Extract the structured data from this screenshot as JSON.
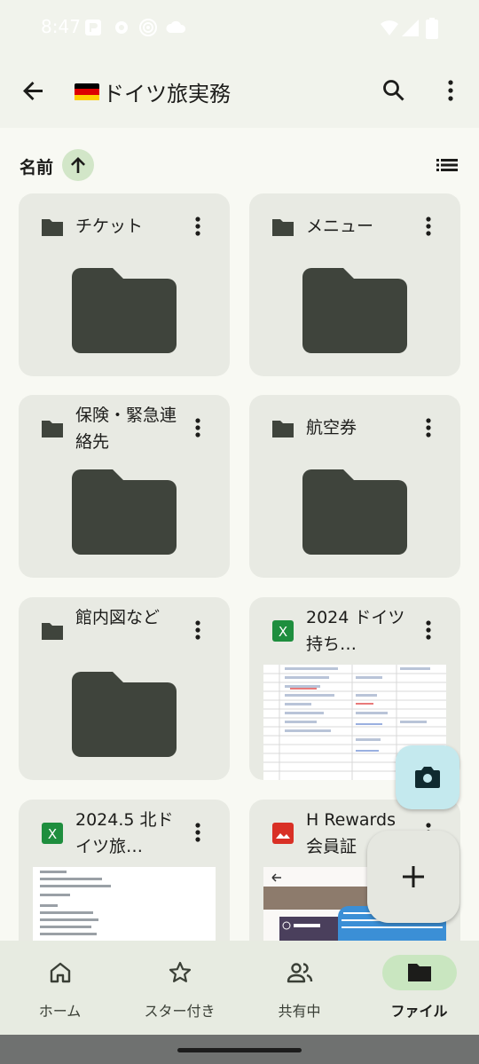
{
  "status_bar": {
    "time": "8:47"
  },
  "app_bar": {
    "flag": "🇩🇪",
    "title": "ドイツ旅実務"
  },
  "sort": {
    "label": "名前",
    "direction": "ascending"
  },
  "files": [
    {
      "name": "チケット",
      "type": "folder"
    },
    {
      "name": "メニュー",
      "type": "folder"
    },
    {
      "name": "保険・緊急連絡先",
      "type": "folder"
    },
    {
      "name": "航空券",
      "type": "folder"
    },
    {
      "name": "館内図など",
      "type": "folder"
    },
    {
      "name": "2024 ドイツ 持ち…",
      "type": "spreadsheet",
      "icon_letter": "X"
    },
    {
      "name": "2024.5 北ドイツ旅…",
      "type": "spreadsheet",
      "icon_letter": "X"
    },
    {
      "name": "H Rewards 会員証",
      "type": "image"
    }
  ],
  "bottom_nav": [
    {
      "label": "ホーム",
      "icon": "home-icon",
      "active": false
    },
    {
      "label": "スター付き",
      "icon": "star-icon",
      "active": false
    },
    {
      "label": "共有中",
      "icon": "people-icon",
      "active": false
    },
    {
      "label": "ファイル",
      "icon": "folder-icon",
      "active": true
    }
  ],
  "colors": {
    "folder": "#3f443c",
    "excel_green": "#1e8e3e",
    "image_red": "#d93025",
    "accent": "#c9e6c0"
  }
}
